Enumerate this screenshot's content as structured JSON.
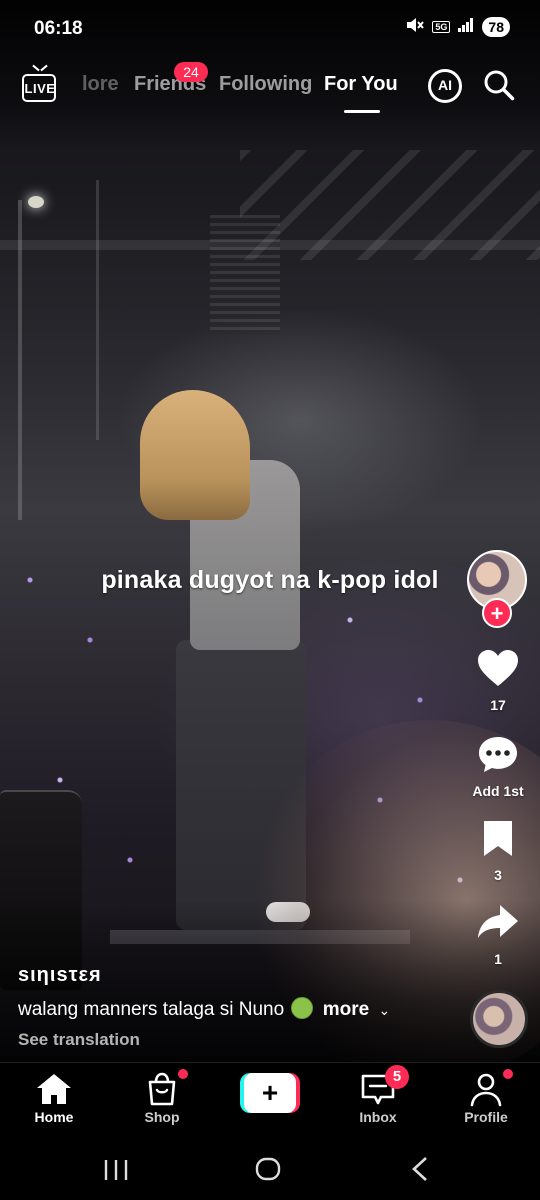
{
  "status_bar": {
    "time": "06:18",
    "network": "5G",
    "battery": "78",
    "icons": [
      "mute-icon",
      "network-5g-icon",
      "signal-icon",
      "battery-icon"
    ]
  },
  "top_nav": {
    "live_label": "LIVE",
    "tabs": [
      {
        "label": "lore",
        "state": "faded"
      },
      {
        "label": "Friends",
        "badge": "24"
      },
      {
        "label": "Following"
      },
      {
        "label": "For You",
        "active": true
      }
    ],
    "ai_label": "AI"
  },
  "video": {
    "overlay_text": "pinaka dugyot na k-pop idol"
  },
  "right_rail": {
    "likes": "17",
    "comments": "Add 1st",
    "bookmarks": "3",
    "shares": "1",
    "follow_symbol": "+"
  },
  "post": {
    "username": "sιηιsτεя",
    "caption": "walang manners talaga si Nuno",
    "caption_emoji": "nauseated-face-emoji",
    "more_label": "more",
    "see_translation": "See translation"
  },
  "bottom_nav": {
    "items": [
      {
        "label": "Home",
        "active": true
      },
      {
        "label": "Shop",
        "dot": true
      },
      {
        "label": "+"
      },
      {
        "label": "Inbox",
        "badge": "5"
      },
      {
        "label": "Profile",
        "dot": true
      }
    ]
  },
  "colors": {
    "accent_red": "#fe2c55",
    "accent_cyan": "#25f4ee"
  }
}
